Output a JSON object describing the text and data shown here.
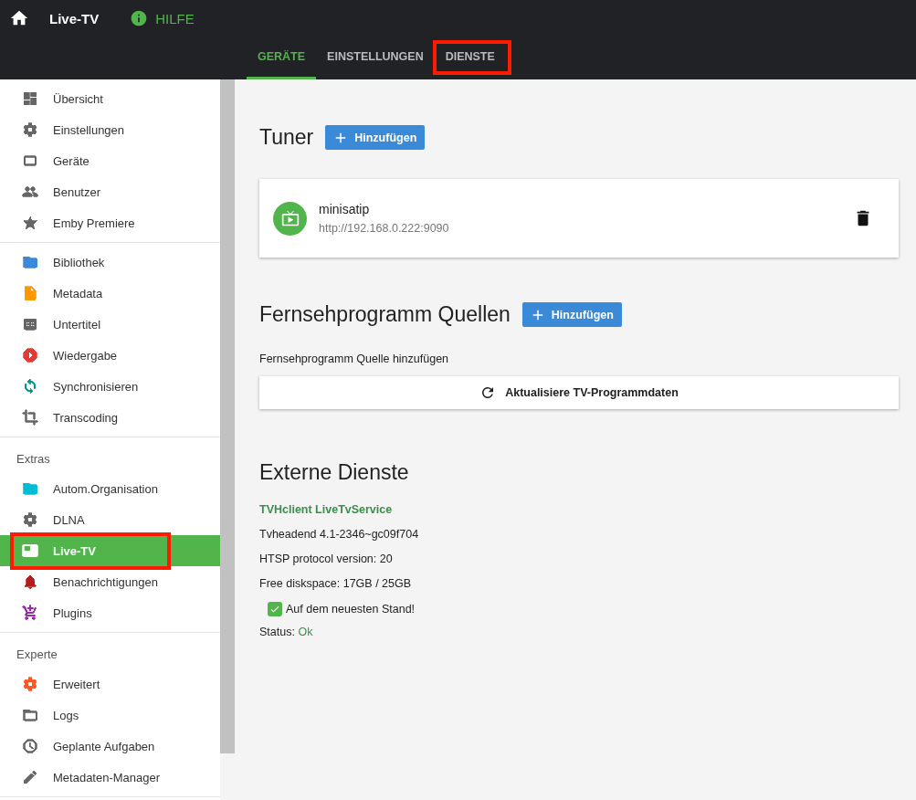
{
  "header": {
    "title": "Live-TV",
    "help": "HILFE"
  },
  "tabs": [
    {
      "label": "GERÄTE",
      "selected": true,
      "highlighted": false
    },
    {
      "label": "EINSTELLUNGEN",
      "selected": false,
      "highlighted": false
    },
    {
      "label": "DIENSTE",
      "selected": false,
      "highlighted": true
    }
  ],
  "sidebar": {
    "sections": [
      {
        "items": [
          {
            "label": "Übersicht",
            "color": "#666666",
            "selected": false,
            "highlighted": false
          },
          {
            "label": "Einstellungen",
            "color": "#666666",
            "selected": false,
            "highlighted": false
          },
          {
            "label": "Geräte",
            "color": "#666666",
            "selected": false,
            "highlighted": false
          },
          {
            "label": "Benutzer",
            "color": "#666666",
            "selected": false,
            "highlighted": false
          },
          {
            "label": "Emby Premiere",
            "color": "#666666",
            "selected": false,
            "highlighted": false
          }
        ]
      },
      {
        "items": [
          {
            "label": "Bibliothek",
            "color": "#3a8ad8",
            "selected": false,
            "highlighted": false
          },
          {
            "label": "Metadata",
            "color": "#ff9800",
            "selected": false,
            "highlighted": false
          },
          {
            "label": "Untertitel",
            "color": "#666666",
            "selected": false,
            "highlighted": false
          },
          {
            "label": "Wiedergabe",
            "color": "#e53935",
            "selected": false,
            "highlighted": false
          },
          {
            "label": "Synchronisieren",
            "color": "#009688",
            "selected": false,
            "highlighted": false
          },
          {
            "label": "Transcoding",
            "color": "#666666",
            "selected": false,
            "highlighted": false
          }
        ]
      },
      {
        "heading": "Extras",
        "items": [
          {
            "label": "Autom.Organisation",
            "color": "#00bcd4",
            "selected": false,
            "highlighted": false
          },
          {
            "label": "DLNA",
            "color": "#666666",
            "selected": false,
            "highlighted": false
          },
          {
            "label": "Live-TV",
            "color": "#ffffff",
            "selected": true,
            "highlighted": true
          },
          {
            "label": "Benachrichtigungen",
            "color": "#b71c1c",
            "selected": false,
            "highlighted": false
          },
          {
            "label": "Plugins",
            "color": "#9c27b0",
            "selected": false,
            "highlighted": false
          }
        ]
      },
      {
        "heading": "Experte",
        "items": [
          {
            "label": "Erweitert",
            "color": "#ff5722",
            "selected": false,
            "highlighted": false
          },
          {
            "label": "Logs",
            "color": "#666666",
            "selected": false,
            "highlighted": false
          },
          {
            "label": "Geplante Aufgaben",
            "color": "#666666",
            "selected": false,
            "highlighted": false
          },
          {
            "label": "Metadaten-Manager",
            "color": "#666666",
            "selected": false,
            "highlighted": false
          }
        ]
      }
    ]
  },
  "tuner": {
    "title": "Tuner",
    "add_button": "Hinzufügen",
    "devices": [
      {
        "name": "minisatip",
        "url": "http://192.168.0.222:9090"
      }
    ]
  },
  "guide": {
    "title": "Fernsehprogramm Quellen",
    "add_button": "Hinzufügen",
    "hint": "Fernsehprogramm Quelle hinzufügen",
    "refresh_button": "Aktualisiere TV-Programmdaten"
  },
  "external": {
    "title": "Externe Dienste",
    "service_link": "TVHclient LiveTvService",
    "lines": [
      "Tvheadend 4.1-2346~gc09f704",
      "HTSP protocol version: 20",
      "Free diskspace: 17GB / 25GB"
    ],
    "update": {
      "label": "Auf dem neuesten Stand!",
      "checked": true
    },
    "status_label": "Status:",
    "status_value": "Ok"
  }
}
